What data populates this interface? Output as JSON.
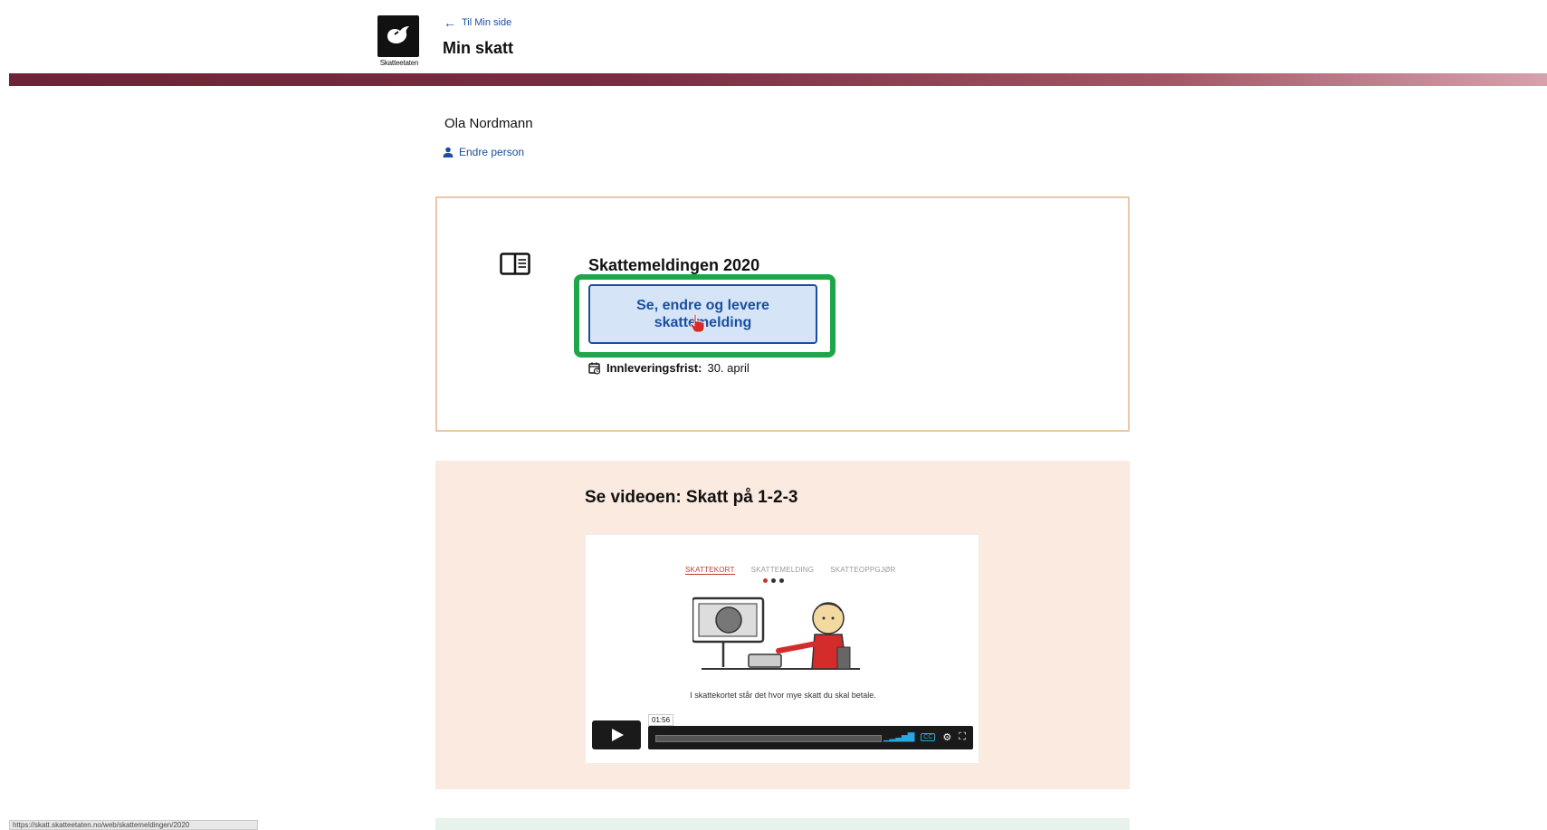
{
  "header": {
    "logo_text": "Skatteetaten",
    "back_link": "Til Min side",
    "title": "Min skatt"
  },
  "user": {
    "name": "Ola Nordmann",
    "change_person": "Endre person"
  },
  "tax_card": {
    "title": "Skattemeldingen 2020",
    "button_label": "Se, endre og levere skattemelding",
    "deadline_label": "Innleveringsfrist:",
    "deadline_value": "30. april"
  },
  "video": {
    "title": "Se videoen: Skatt på 1-2-3",
    "tabs": [
      "SKATTEKORT",
      "SKATTEMELDING",
      "SKATTEOPPGJØR"
    ],
    "caption": "I skattekortet står det hvor mye skatt du skal betale.",
    "time": "01:56"
  },
  "status_bar": {
    "url": "https://skatt.skatteetaten.no/web/skattemeldingen/2020"
  },
  "colors": {
    "brand_band": "#6e2436",
    "link": "#1a4fa0",
    "highlight": "#1ea64a",
    "card_border": "#e8c9a8",
    "video_bg": "#faeae0"
  }
}
